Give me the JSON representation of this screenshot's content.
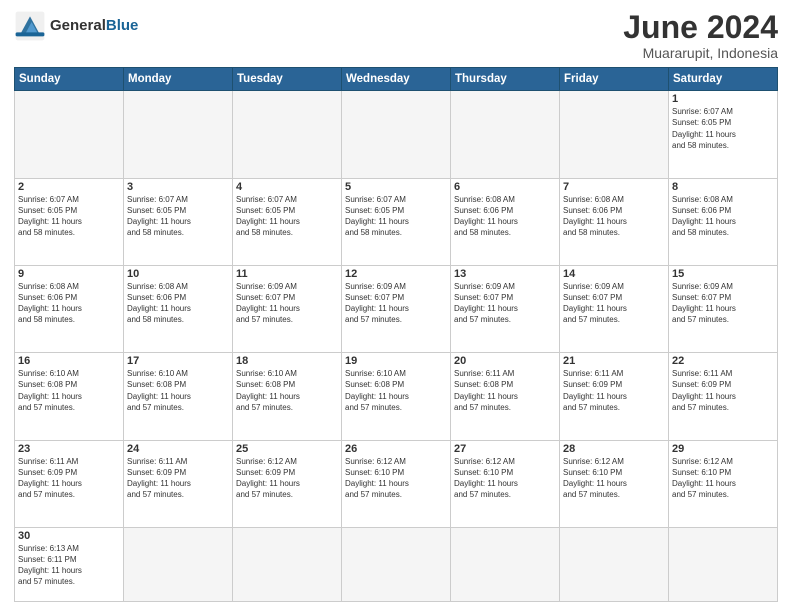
{
  "header": {
    "logo_general": "General",
    "logo_blue": "Blue",
    "month_title": "June 2024",
    "location": "Muararupit, Indonesia"
  },
  "weekdays": [
    "Sunday",
    "Monday",
    "Tuesday",
    "Wednesday",
    "Thursday",
    "Friday",
    "Saturday"
  ],
  "weeks": [
    [
      {
        "day": "",
        "info": ""
      },
      {
        "day": "",
        "info": ""
      },
      {
        "day": "",
        "info": ""
      },
      {
        "day": "",
        "info": ""
      },
      {
        "day": "",
        "info": ""
      },
      {
        "day": "",
        "info": ""
      },
      {
        "day": "1",
        "info": "Sunrise: 6:07 AM\nSunset: 6:05 PM\nDaylight: 11 hours\nand 58 minutes."
      }
    ],
    [
      {
        "day": "2",
        "info": "Sunrise: 6:07 AM\nSunset: 6:05 PM\nDaylight: 11 hours\nand 58 minutes."
      },
      {
        "day": "3",
        "info": "Sunrise: 6:07 AM\nSunset: 6:05 PM\nDaylight: 11 hours\nand 58 minutes."
      },
      {
        "day": "4",
        "info": "Sunrise: 6:07 AM\nSunset: 6:05 PM\nDaylight: 11 hours\nand 58 minutes."
      },
      {
        "day": "5",
        "info": "Sunrise: 6:07 AM\nSunset: 6:05 PM\nDaylight: 11 hours\nand 58 minutes."
      },
      {
        "day": "6",
        "info": "Sunrise: 6:08 AM\nSunset: 6:06 PM\nDaylight: 11 hours\nand 58 minutes."
      },
      {
        "day": "7",
        "info": "Sunrise: 6:08 AM\nSunset: 6:06 PM\nDaylight: 11 hours\nand 58 minutes."
      },
      {
        "day": "8",
        "info": "Sunrise: 6:08 AM\nSunset: 6:06 PM\nDaylight: 11 hours\nand 58 minutes."
      }
    ],
    [
      {
        "day": "9",
        "info": "Sunrise: 6:08 AM\nSunset: 6:06 PM\nDaylight: 11 hours\nand 58 minutes."
      },
      {
        "day": "10",
        "info": "Sunrise: 6:08 AM\nSunset: 6:06 PM\nDaylight: 11 hours\nand 58 minutes."
      },
      {
        "day": "11",
        "info": "Sunrise: 6:09 AM\nSunset: 6:07 PM\nDaylight: 11 hours\nand 57 minutes."
      },
      {
        "day": "12",
        "info": "Sunrise: 6:09 AM\nSunset: 6:07 PM\nDaylight: 11 hours\nand 57 minutes."
      },
      {
        "day": "13",
        "info": "Sunrise: 6:09 AM\nSunset: 6:07 PM\nDaylight: 11 hours\nand 57 minutes."
      },
      {
        "day": "14",
        "info": "Sunrise: 6:09 AM\nSunset: 6:07 PM\nDaylight: 11 hours\nand 57 minutes."
      },
      {
        "day": "15",
        "info": "Sunrise: 6:09 AM\nSunset: 6:07 PM\nDaylight: 11 hours\nand 57 minutes."
      }
    ],
    [
      {
        "day": "16",
        "info": "Sunrise: 6:10 AM\nSunset: 6:08 PM\nDaylight: 11 hours\nand 57 minutes."
      },
      {
        "day": "17",
        "info": "Sunrise: 6:10 AM\nSunset: 6:08 PM\nDaylight: 11 hours\nand 57 minutes."
      },
      {
        "day": "18",
        "info": "Sunrise: 6:10 AM\nSunset: 6:08 PM\nDaylight: 11 hours\nand 57 minutes."
      },
      {
        "day": "19",
        "info": "Sunrise: 6:10 AM\nSunset: 6:08 PM\nDaylight: 11 hours\nand 57 minutes."
      },
      {
        "day": "20",
        "info": "Sunrise: 6:11 AM\nSunset: 6:08 PM\nDaylight: 11 hours\nand 57 minutes."
      },
      {
        "day": "21",
        "info": "Sunrise: 6:11 AM\nSunset: 6:09 PM\nDaylight: 11 hours\nand 57 minutes."
      },
      {
        "day": "22",
        "info": "Sunrise: 6:11 AM\nSunset: 6:09 PM\nDaylight: 11 hours\nand 57 minutes."
      }
    ],
    [
      {
        "day": "23",
        "info": "Sunrise: 6:11 AM\nSunset: 6:09 PM\nDaylight: 11 hours\nand 57 minutes."
      },
      {
        "day": "24",
        "info": "Sunrise: 6:11 AM\nSunset: 6:09 PM\nDaylight: 11 hours\nand 57 minutes."
      },
      {
        "day": "25",
        "info": "Sunrise: 6:12 AM\nSunset: 6:09 PM\nDaylight: 11 hours\nand 57 minutes."
      },
      {
        "day": "26",
        "info": "Sunrise: 6:12 AM\nSunset: 6:10 PM\nDaylight: 11 hours\nand 57 minutes."
      },
      {
        "day": "27",
        "info": "Sunrise: 6:12 AM\nSunset: 6:10 PM\nDaylight: 11 hours\nand 57 minutes."
      },
      {
        "day": "28",
        "info": "Sunrise: 6:12 AM\nSunset: 6:10 PM\nDaylight: 11 hours\nand 57 minutes."
      },
      {
        "day": "29",
        "info": "Sunrise: 6:12 AM\nSunset: 6:10 PM\nDaylight: 11 hours\nand 57 minutes."
      }
    ],
    [
      {
        "day": "30",
        "info": "Sunrise: 6:13 AM\nSunset: 6:11 PM\nDaylight: 11 hours\nand 57 minutes."
      },
      {
        "day": "",
        "info": ""
      },
      {
        "day": "",
        "info": ""
      },
      {
        "day": "",
        "info": ""
      },
      {
        "day": "",
        "info": ""
      },
      {
        "day": "",
        "info": ""
      },
      {
        "day": "",
        "info": ""
      }
    ]
  ]
}
